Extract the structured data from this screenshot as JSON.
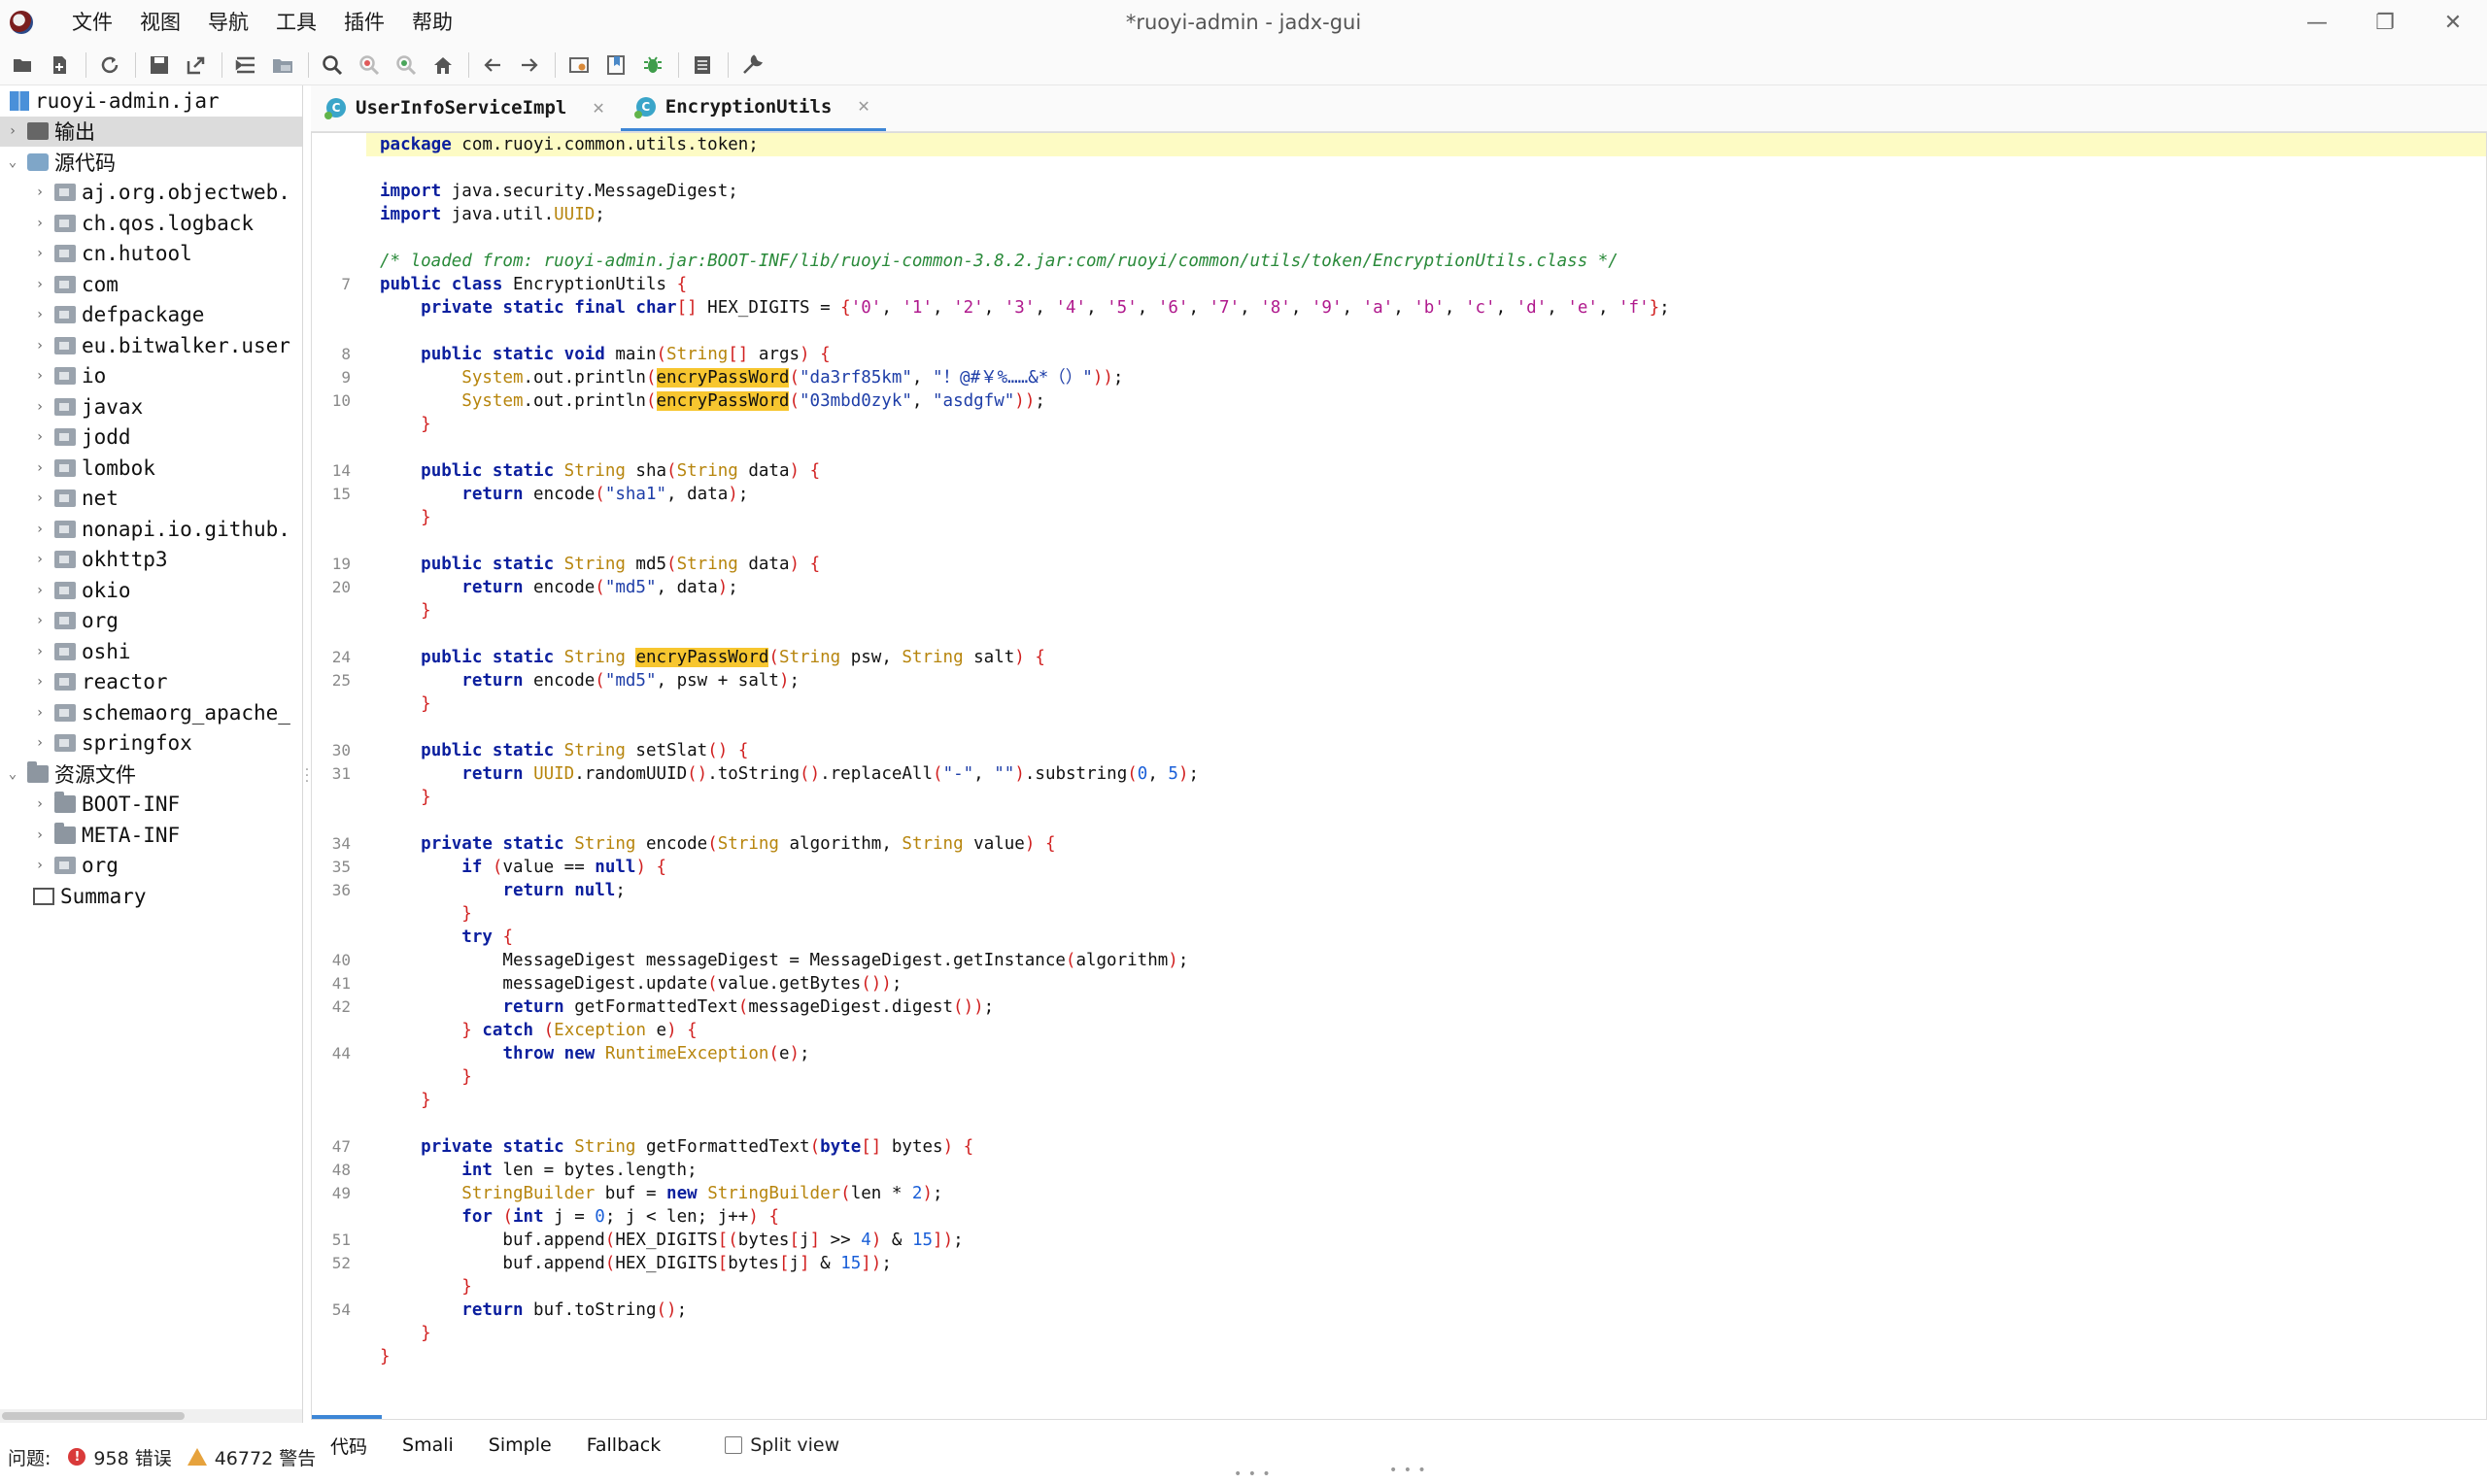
{
  "window": {
    "title": "*ruoyi-admin - jadx-gui",
    "minimize": "—",
    "maximize": "❐",
    "close": "✕"
  },
  "menu": [
    "文件",
    "视图",
    "导航",
    "工具",
    "插件",
    "帮助"
  ],
  "toolbar_icons": [
    "open-file-icon",
    "add-files-icon",
    "reload-icon",
    "save-icon",
    "export-icon",
    "sync-tree-icon",
    "flatten-packages-icon",
    "search-icon",
    "find-usage-icon",
    "find-class-icon",
    "home-icon",
    "back-icon",
    "forward-icon",
    "deobfuscation-icon",
    "bookmark-icon",
    "debug-icon",
    "log-icon",
    "preferences-icon"
  ],
  "tree": {
    "root": "ruoyi-admin.jar",
    "output": "输出",
    "source_root": "源代码",
    "packages": [
      "aj.org.objectweb.",
      "ch.qos.logback",
      "cn.hutool",
      "com",
      "defpackage",
      "eu.bitwalker.user",
      "io",
      "javax",
      "jodd",
      "lombok",
      "net",
      "nonapi.io.github.",
      "okhttp3",
      "okio",
      "org",
      "oshi",
      "reactor",
      "schemaorg_apache_",
      "springfox"
    ],
    "resources_root": "资源文件",
    "resources": [
      "BOOT-INF",
      "META-INF",
      "org"
    ],
    "summary": "Summary"
  },
  "tabs": [
    {
      "label": "UserInfoServiceImpl",
      "icon": "C",
      "active": false
    },
    {
      "label": "EncryptionUtils",
      "icon": "C",
      "active": true
    }
  ],
  "code": {
    "package_line": "package com.ruoyi.common.utils.token;",
    "import1": "import java.security.MessageDigest;",
    "import2": "import java.util.UUID;",
    "comment": "/* loaded from: ruoyi-admin.jar:BOOT-INF/lib/ruoyi-common-3.8.2.jar:com/ruoyi/common/utils/token/EncryptionUtils.class */",
    "class_name": "EncryptionUtils",
    "hex_digits": [
      "'0'",
      "'1'",
      "'2'",
      "'3'",
      "'4'",
      "'5'",
      "'6'",
      "'7'",
      "'8'",
      "'9'",
      "'a'",
      "'b'",
      "'c'",
      "'d'",
      "'e'",
      "'f'"
    ],
    "main_arg1_a": "\"da3rf85km\"",
    "main_arg1_b": "\"！@#￥%……&*（）\"",
    "main_arg2_a": "\"03mbd0zyk\"",
    "main_arg2_b": "\"asdgfw\"",
    "sha1": "\"sha1\"",
    "md5": "\"md5\"",
    "dash": "\"-\"",
    "empty": "\"\"",
    "line_numbers": {
      "class": "7",
      "main": "8",
      "println1": "9",
      "println2": "10",
      "sha": "14",
      "sha_ret": "15",
      "md5": "19",
      "md5_ret": "20",
      "encry": "24",
      "encry_ret": "25",
      "salt": "30",
      "salt_ret": "31",
      "encode": "34",
      "if": "35",
      "retnull": "36",
      "getinst": "40",
      "update": "41",
      "retfmt": "42",
      "throw": "44",
      "fmt": "47",
      "len": "48",
      "buf": "49",
      "append1": "51",
      "append2": "52",
      "retbuf": "54"
    }
  },
  "view_tabs": [
    "代码",
    "Smali",
    "Simple",
    "Fallback"
  ],
  "split_view": "Split view",
  "status": {
    "label": "问题:",
    "errors": "958 错误",
    "warnings": "46772 警告"
  }
}
